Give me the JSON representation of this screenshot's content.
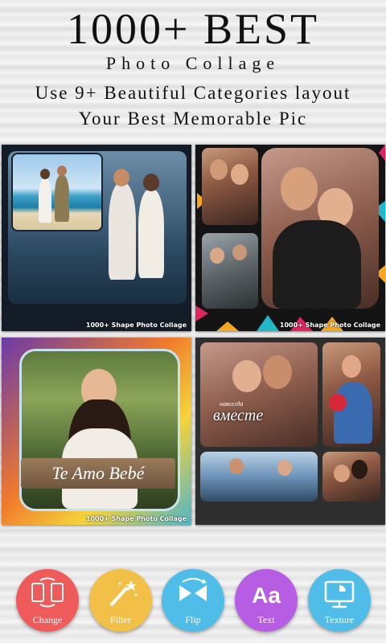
{
  "header": {
    "title": "1000+ BEST",
    "subtitle": "Photo Collage",
    "line1": "Use 9+ Beautiful Categories layout",
    "line2": "Your Best Memorable Pic"
  },
  "tiles": [
    {
      "caption": "1000+ Shape Photo Collage"
    },
    {
      "caption": "1000+ Shape Photo Collage"
    },
    {
      "caption": "1000+ Shape Photo Collage",
      "sign_text": "Te Amo Bebé"
    },
    {
      "overlay_text": "вместе",
      "overlay_small": "навсегда"
    }
  ],
  "toolbar": [
    {
      "label": "Change",
      "icon": "change-icon",
      "color": "#ef5a5a"
    },
    {
      "label": "Filter",
      "icon": "magic-wand-icon",
      "color": "#f2bf47"
    },
    {
      "label": "Flip",
      "icon": "flip-icon",
      "color": "#4fbde8"
    },
    {
      "label": "Text",
      "icon": "text-icon",
      "color": "#b65de3"
    },
    {
      "label": "Texture",
      "icon": "texture-icon",
      "color": "#4fbde8"
    }
  ]
}
